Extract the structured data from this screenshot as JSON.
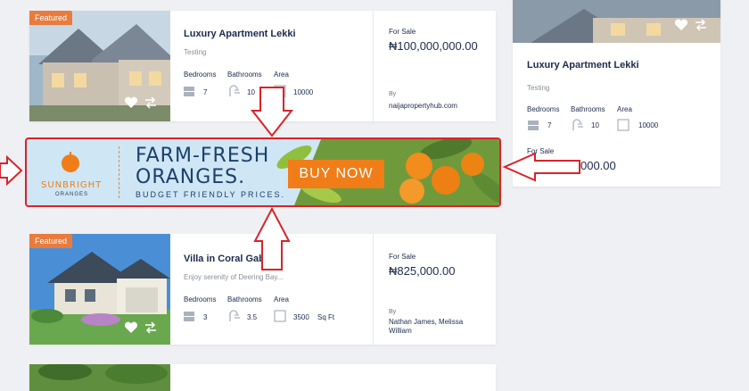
{
  "listings": [
    {
      "badge": "Featured",
      "title": "Luxury Apartment Lekki",
      "subtitle": "Testing",
      "labels": {
        "bedrooms": "Bedrooms",
        "bathrooms": "Bathrooms",
        "area": "Area"
      },
      "bedrooms": "7",
      "bathrooms": "10",
      "area": "10000",
      "status": "For Sale",
      "price": "₦100,000,000.00",
      "by_label": "By",
      "agent": "naijapropertyhub.com"
    },
    {
      "badge": "Featured",
      "title": "Villa in Coral Gables",
      "subtitle": "Enjoy serenity of Deering Bay...",
      "labels": {
        "bedrooms": "Bedrooms",
        "bathrooms": "Bathrooms",
        "area": "Area"
      },
      "bedrooms": "3",
      "bathrooms": "3.5",
      "area": "3500",
      "area_unit": "Sq Ft",
      "status": "For Sale",
      "price": "₦825,000.00",
      "by_label": "By",
      "agent_line1": "Nathan James, Melissa",
      "agent_line2": "William"
    }
  ],
  "side_card": {
    "title": "Luxury Apartment Lekki",
    "subtitle": "Testing",
    "labels": {
      "bedrooms": "Bedrooms",
      "bathrooms": "Bathrooms",
      "area": "Area"
    },
    "bedrooms": "7",
    "bathrooms": "10",
    "area": "10000",
    "status": "For Sale",
    "price": "₦100,000,000.00"
  },
  "ad": {
    "brand_line1": "SUNBRIGHT",
    "brand_line2": "ORANGES",
    "headline_line1": "FARM-FRESH",
    "headline_line2": "ORANGES.",
    "tagline": "BUDGET FRIENDLY PRICES.",
    "cta": "BUY NOW"
  },
  "colors": {
    "accent": "#e97b3d",
    "annotation": "#d8232a",
    "navy": "#1d2a4d",
    "ad_bg": "#cfe6f4"
  }
}
